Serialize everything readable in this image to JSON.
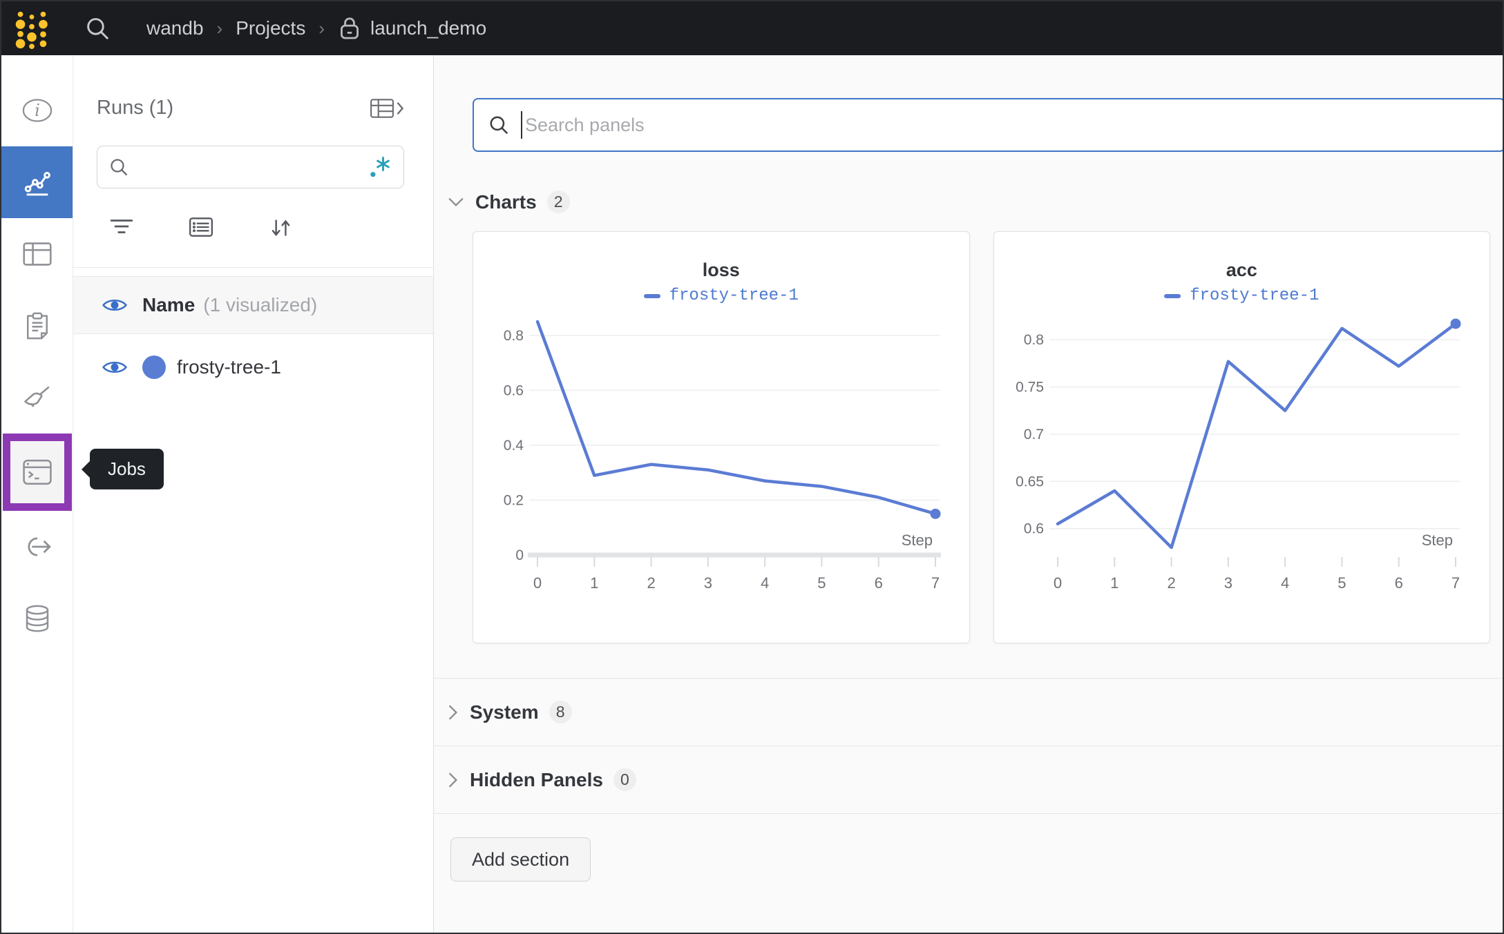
{
  "topbar": {
    "breadcrumb": {
      "items": [
        "wandb",
        "Projects",
        "launch_demo"
      ],
      "separator": "›"
    }
  },
  "sidebar": {
    "tooltip": "Jobs"
  },
  "runs_panel": {
    "title": "Runs (1)",
    "search_placeholder": "",
    "header": {
      "name": "Name",
      "sub": "(1 visualized)"
    },
    "rows": [
      {
        "name": "frosty-tree-1"
      }
    ]
  },
  "main": {
    "search_placeholder": "Search panels",
    "sections": [
      {
        "label": "Charts",
        "count": "2",
        "state": "expanded"
      },
      {
        "label": "System",
        "count": "8",
        "state": "collapsed"
      },
      {
        "label": "Hidden Panels",
        "count": "0",
        "state": "collapsed"
      }
    ],
    "add_section_label": "Add section"
  },
  "chart_data": [
    {
      "type": "line",
      "title": "loss",
      "x": [
        0,
        1,
        2,
        3,
        4,
        5,
        6,
        7
      ],
      "series": [
        {
          "name": "frosty-tree-1",
          "values": [
            0.85,
            0.29,
            0.33,
            0.31,
            0.27,
            0.25,
            0.21,
            0.15
          ]
        }
      ],
      "xlabel": "Step",
      "yticks": [
        0,
        0.2,
        0.4,
        0.6,
        0.8
      ],
      "ylim": [
        0,
        0.87
      ],
      "zero_band": true,
      "grid": true,
      "legend_position": "top",
      "line_color": "#5b7cd4"
    },
    {
      "type": "line",
      "title": "acc",
      "x": [
        0,
        1,
        2,
        3,
        4,
        5,
        6,
        7
      ],
      "series": [
        {
          "name": "frosty-tree-1",
          "values": [
            0.605,
            0.64,
            0.58,
            0.777,
            0.725,
            0.812,
            0.772,
            0.817
          ]
        }
      ],
      "xlabel": "Step",
      "yticks": [
        0.6,
        0.65,
        0.7,
        0.75,
        0.8
      ],
      "ylim": [
        0.572,
        0.825
      ],
      "zero_band": false,
      "grid": true,
      "legend_position": "top",
      "line_color": "#5b7cd4"
    }
  ],
  "colors": {
    "topbar-bg": "#1a1c1f",
    "accent-blue": "#4477c4",
    "run-color": "#5a7dd4",
    "eye-blue": "#3a6fc9",
    "regex-teal": "#2aa0b7",
    "jobs-purple": "#8d39b4",
    "logo-yellow": "#fcc32d",
    "tooltip-bg": "#1f2226",
    "main-bg": "#fafafa",
    "focus-border": "#3f74c4"
  }
}
